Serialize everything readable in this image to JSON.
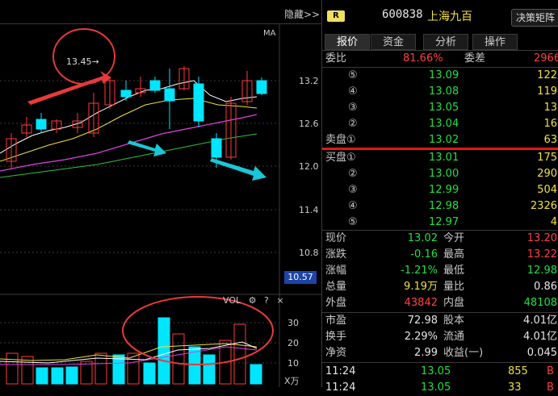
{
  "chart": {
    "hide_label": "隐藏>>",
    "ma_label": "MA",
    "price_marker": "13.45→",
    "current_price_tag": "10.57",
    "y_axis": [
      "13.2",
      "12.6",
      "12.0",
      "11.4",
      "10.8"
    ],
    "vol_label": "VOL",
    "vol_help": "?",
    "vol_close": "×",
    "vol_axis": [
      "30",
      "20",
      "10"
    ],
    "vol_unit": "X万",
    "colors": {
      "up": "#ff3a3a",
      "down": "#00e6ff",
      "annot": "#e83a3a",
      "ma_white": "#ffffff",
      "ma_yellow": "#f0e040",
      "ma_magenta": "#e040e0",
      "ma_green": "#30c040"
    }
  },
  "panel": {
    "badge": "R",
    "code": "600838",
    "name": "上海九百",
    "strategy_button": "决策矩阵",
    "tabs": [
      "报价",
      "资金",
      "分析",
      "操作"
    ],
    "weibi": {
      "label": "委比",
      "value": "81.66%",
      "label2": "委差",
      "value2": "2966"
    },
    "sell_levels": [
      {
        "label": "⑤",
        "price": "13.09",
        "vol": "122"
      },
      {
        "label": "④",
        "price": "13.08",
        "vol": "119"
      },
      {
        "label": "③",
        "price": "13.05",
        "vol": "13"
      },
      {
        "label": "②",
        "price": "13.04",
        "vol": "16"
      },
      {
        "label": "卖盘①",
        "price": "13.02",
        "vol": "63"
      }
    ],
    "buy_levels": [
      {
        "label": "买盘①",
        "price": "13.01",
        "vol": "175"
      },
      {
        "label": "②",
        "price": "13.00",
        "vol": "290"
      },
      {
        "label": "③",
        "price": "12.99",
        "vol": "504"
      },
      {
        "label": "④",
        "price": "12.98",
        "vol": "2326"
      },
      {
        "label": "⑤",
        "price": "12.97",
        "vol": "4"
      }
    ],
    "stats": [
      {
        "l1": "现价",
        "v1": "13.02",
        "c1": "green",
        "l2": "今开",
        "v2": "13.20",
        "c2": "red"
      },
      {
        "l1": "涨跌",
        "v1": "-0.16",
        "c1": "green",
        "l2": "最高",
        "v2": "13.22",
        "c2": "red"
      },
      {
        "l1": "涨幅",
        "v1": "-1.21%",
        "c1": "green",
        "l2": "最低",
        "v2": "12.98",
        "c2": "green"
      },
      {
        "l1": "总量",
        "v1": "9.19万",
        "c1": "yellow",
        "l2": "量比",
        "v2": "0.86",
        "c2": "white"
      },
      {
        "l1": "外盘",
        "v1": "43842",
        "c1": "red",
        "l2": "内盘",
        "v2": "48108",
        "c2": "green"
      }
    ],
    "stats2": [
      {
        "l1": "市盈",
        "v1": "72.98",
        "l2": "股本",
        "v2": "4.01亿"
      },
      {
        "l1": "换手",
        "v1": "2.29%",
        "l2": "流通",
        "v2": "4.01亿"
      },
      {
        "l1": "净资",
        "v1": "2.99",
        "l2": "收益(一)",
        "v2": "0.045"
      }
    ],
    "ticks": [
      {
        "time": "11:24",
        "price": "13.05",
        "vol": "855",
        "flag": "B"
      },
      {
        "time": "11:24",
        "price": "13.05",
        "vol": "33",
        "flag": "B"
      }
    ]
  }
}
